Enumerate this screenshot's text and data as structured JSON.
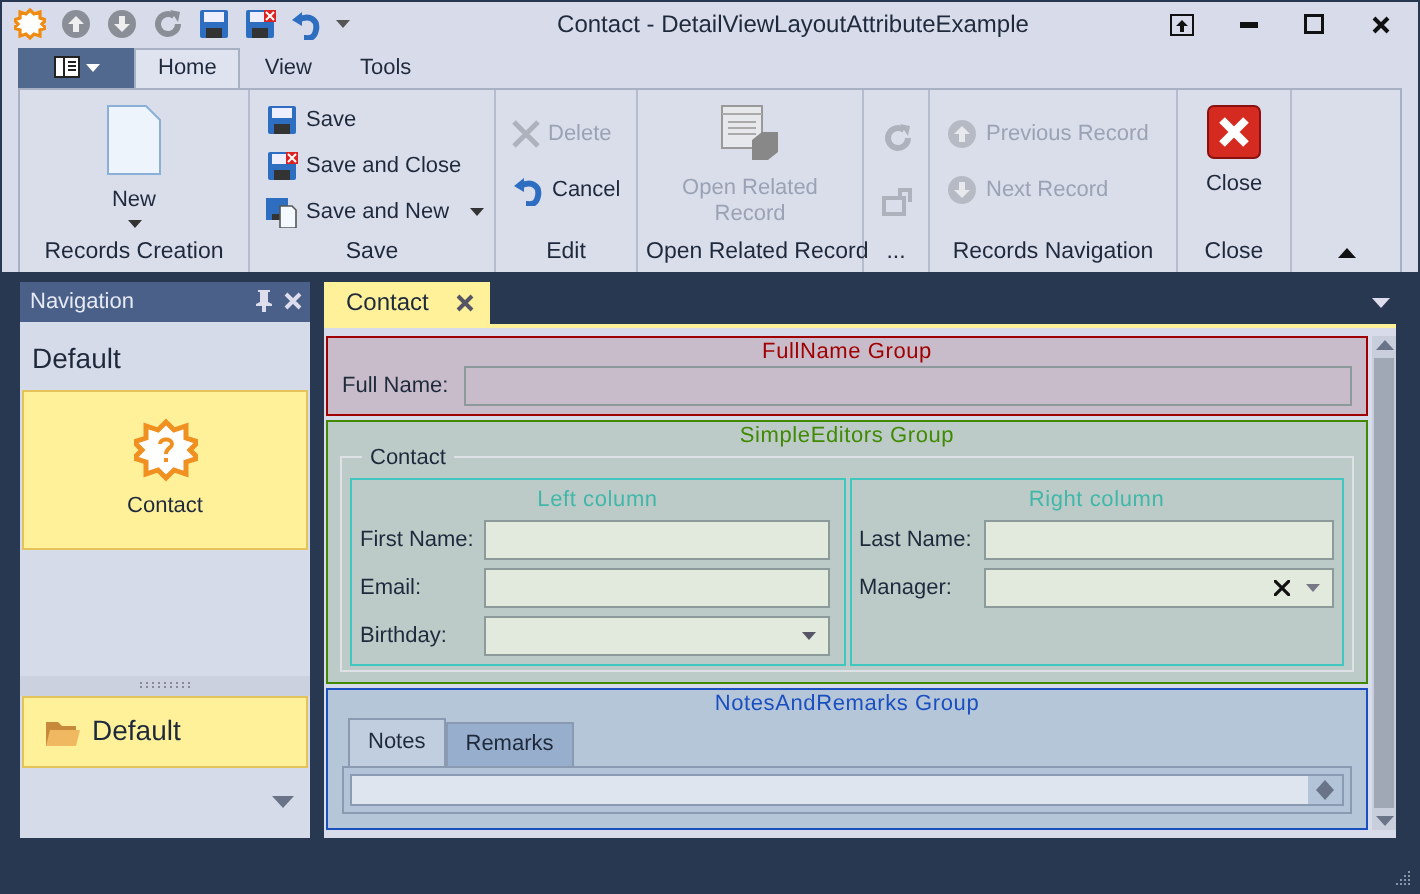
{
  "window": {
    "title": "Contact - DetailViewLayoutAttributeExample"
  },
  "ribbon": {
    "tabs": [
      {
        "label": "Home",
        "selected": true
      },
      {
        "label": "View",
        "selected": false
      },
      {
        "label": "Tools",
        "selected": false
      }
    ],
    "groups": [
      {
        "caption": "Records Creation",
        "items": [
          {
            "kind": "large",
            "label": "New",
            "dropdown": true,
            "disabled": false
          }
        ]
      },
      {
        "caption": "Save",
        "items": [
          {
            "kind": "small",
            "label": "Save",
            "dropdown": false,
            "disabled": false
          },
          {
            "kind": "small",
            "label": "Save and Close",
            "dropdown": false,
            "disabled": false
          },
          {
            "kind": "small",
            "label": "Save and New",
            "dropdown": true,
            "disabled": false
          }
        ]
      },
      {
        "caption": "Edit",
        "items": [
          {
            "kind": "small",
            "label": "Delete",
            "dropdown": false,
            "disabled": true
          },
          {
            "kind": "small",
            "label": "Cancel",
            "dropdown": false,
            "disabled": false
          }
        ]
      },
      {
        "caption": "Open Related Record",
        "items": [
          {
            "kind": "large",
            "label": "Open Related Record",
            "dropdown": false,
            "disabled": true
          }
        ]
      },
      {
        "caption": "...",
        "items": [
          {
            "kind": "icon",
            "dropdown": false,
            "disabled": true
          },
          {
            "kind": "icon",
            "dropdown": false,
            "disabled": true
          }
        ]
      },
      {
        "caption": "Records Navigation",
        "items": [
          {
            "kind": "small",
            "label": "Previous Record",
            "dropdown": false,
            "disabled": true
          },
          {
            "kind": "small",
            "label": "Next Record",
            "dropdown": false,
            "disabled": true
          }
        ]
      },
      {
        "caption": "Close",
        "items": [
          {
            "kind": "large",
            "label": "Close",
            "dropdown": false,
            "disabled": false
          }
        ]
      }
    ]
  },
  "navigation": {
    "title": "Navigation",
    "group_header": "Default",
    "items": [
      {
        "label": "Contact",
        "selected": true
      }
    ],
    "groups": [
      {
        "label": "Default",
        "selected": true
      }
    ]
  },
  "document_tabs": [
    {
      "label": "Contact",
      "selected": true
    }
  ],
  "layout_groups": [
    {
      "kind": "fields",
      "caption": "FullName Group",
      "color": "#a00000",
      "fields": [
        {
          "label": "Full Name:",
          "kind": "text"
        }
      ]
    },
    {
      "kind": "columns",
      "caption": "SimpleEditors Group",
      "color": "#3f8a00",
      "frame_caption": "Contact",
      "columns": [
        {
          "caption": "Left column",
          "fields": [
            {
              "label": "First Name:",
              "kind": "text"
            },
            {
              "label": "Email:",
              "kind": "text"
            },
            {
              "label": "Birthday:",
              "kind": "dropdown"
            }
          ]
        },
        {
          "caption": "Right column",
          "fields": [
            {
              "label": "Last Name:",
              "kind": "text"
            },
            {
              "label": "Manager:",
              "kind": "lookup"
            }
          ]
        }
      ]
    },
    {
      "kind": "tabs",
      "caption": "NotesAndRemarks Group",
      "color": "#1a4fc0",
      "tabs": [
        {
          "label": "Notes",
          "selected": true
        },
        {
          "label": "Remarks",
          "selected": false
        }
      ]
    }
  ]
}
